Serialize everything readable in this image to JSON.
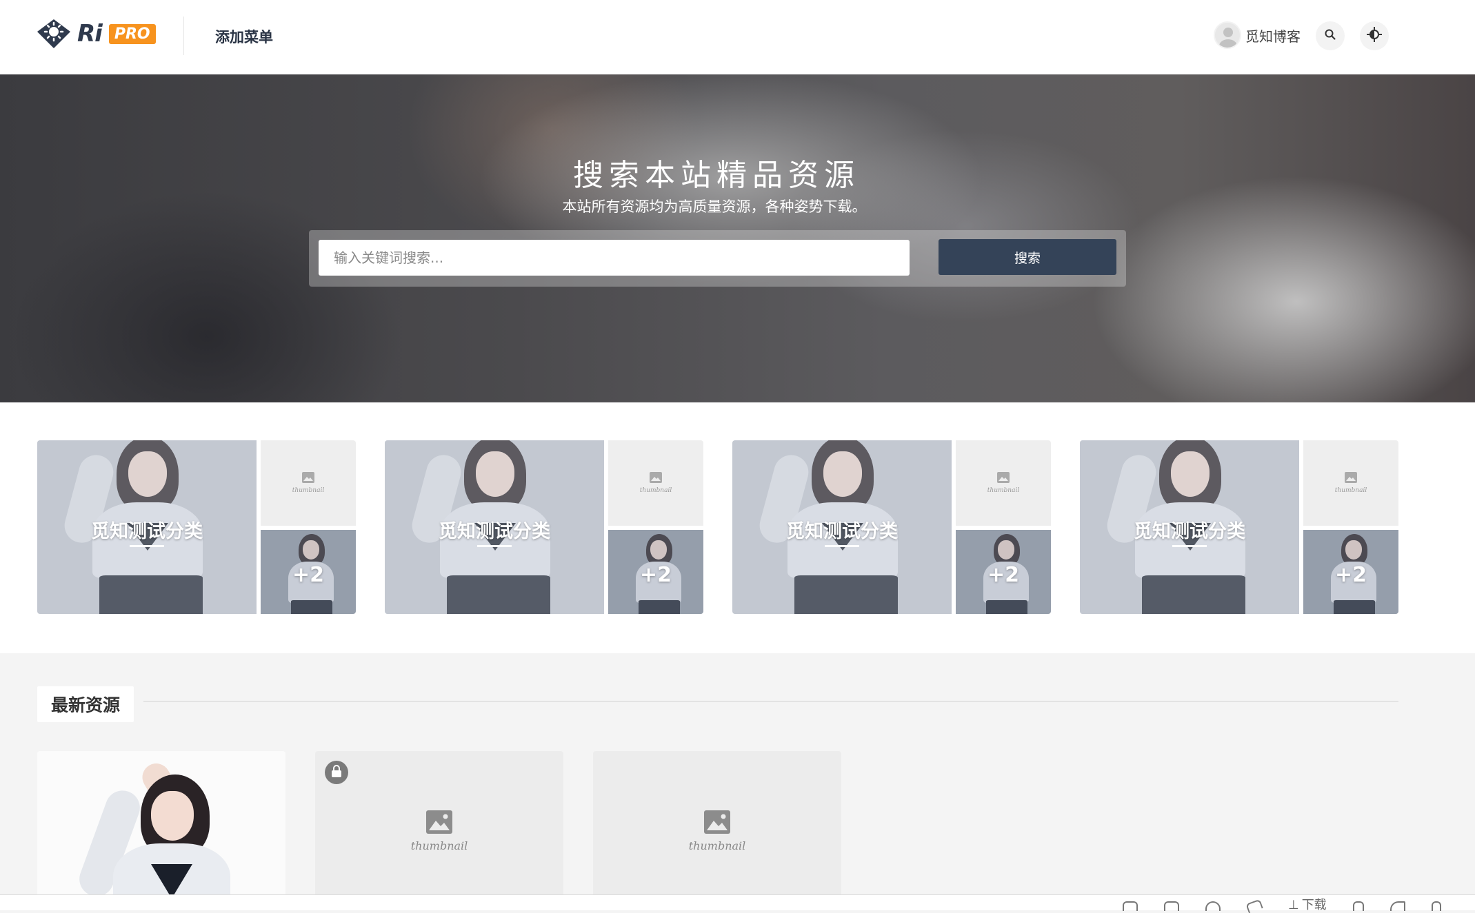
{
  "header": {
    "logo": {
      "ri": "Ri",
      "pro": "PRO"
    },
    "nav_items": [
      {
        "label": "添加菜单"
      }
    ],
    "user_name": "觅知博客",
    "search_icon": "search-icon",
    "theme_icon": "theme-toggle-icon"
  },
  "hero": {
    "title": "搜索本站精品资源",
    "subtitle": "本站所有资源均为高质量资源，各种姿势下载。",
    "search_placeholder": "输入关键词搜索...",
    "search_button": "搜索"
  },
  "categories": [
    {
      "title": "觅知测试分类",
      "more": "+2",
      "thumb_label": "thumbnail"
    },
    {
      "title": "觅知测试分类",
      "more": "+2",
      "thumb_label": "thumbnail"
    },
    {
      "title": "觅知测试分类",
      "more": "+2",
      "thumb_label": "thumbnail"
    },
    {
      "title": "觅知测试分类",
      "more": "+2",
      "thumb_label": "thumbnail"
    }
  ],
  "latest": {
    "title": "最新资源",
    "posts": [
      {
        "type": "image"
      },
      {
        "type": "placeholder",
        "locked": true,
        "thumb_label": "thumbnail"
      },
      {
        "type": "placeholder",
        "locked": false,
        "thumb_label": "thumbnail"
      }
    ]
  },
  "bottom_toolbar": {
    "download_label": "下载"
  },
  "colors": {
    "accent": "#344358",
    "logo_orange": "#f7931e",
    "logo_dark": "#2f3a4d"
  }
}
